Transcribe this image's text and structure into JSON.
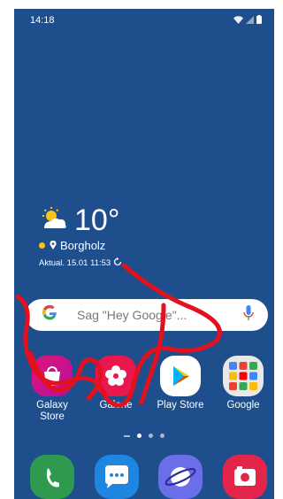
{
  "status_bar": {
    "time": "14:18",
    "icons": [
      "wifi-icon",
      "signal-icon",
      "battery-icon"
    ]
  },
  "weather": {
    "temperature": "10°",
    "location": "Borgholz",
    "updated": "Aktual. 15.01 11:53",
    "icon": "partly-sunny-icon"
  },
  "search": {
    "placeholder": "Sag \"Hey Google\"..."
  },
  "apps": [
    {
      "label": "Galaxy\nStore",
      "icon": "shopping-bag-icon",
      "color": "#d1148a"
    },
    {
      "label": "Galerie",
      "icon": "flower-icon",
      "color": "#e8174c"
    },
    {
      "label": "Play Store",
      "icon": "play-store-icon",
      "color": "#ffffff"
    },
    {
      "label": "Google",
      "icon": "google-folder-icon",
      "color": "#e8e8e8"
    }
  ],
  "dock": [
    {
      "icon": "phone-icon",
      "color": "#2e9a4e"
    },
    {
      "icon": "messages-icon",
      "color": "#1e86e0"
    },
    {
      "icon": "internet-icon",
      "color": "#6a6ee8"
    },
    {
      "icon": "camera-icon",
      "color": "#e4254a"
    }
  ],
  "colors": {
    "background": "#1e4e8c",
    "scribble": "#e3101e"
  }
}
